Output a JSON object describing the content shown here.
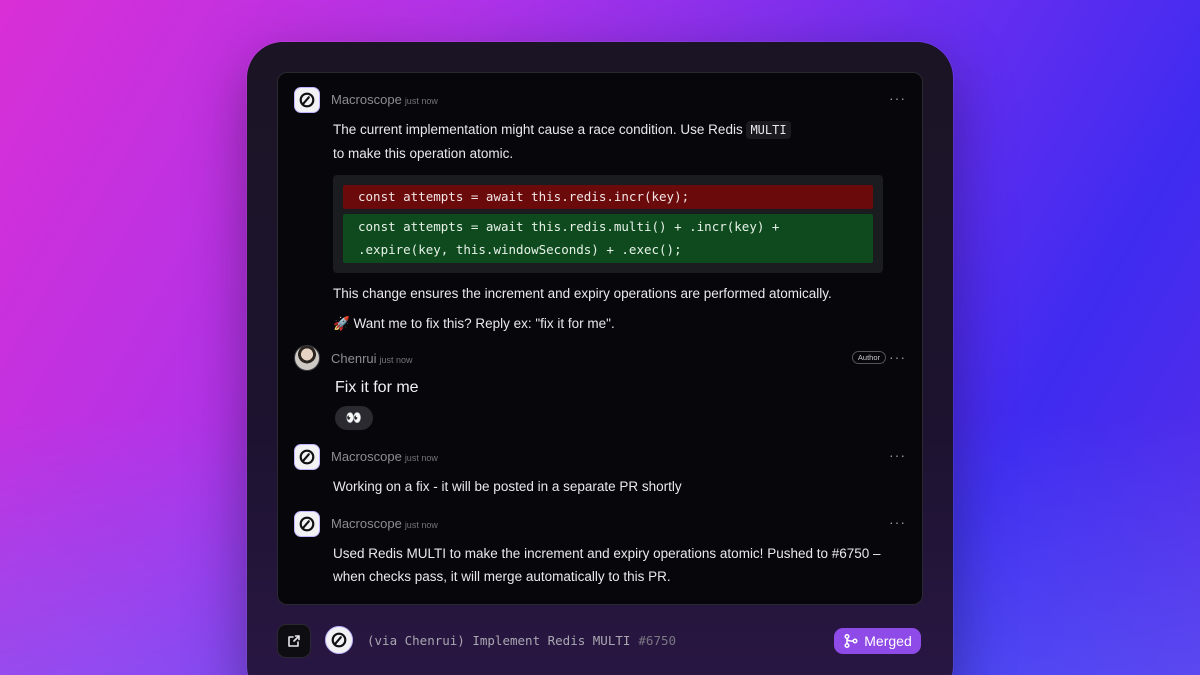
{
  "comments": [
    {
      "author": "Macroscope",
      "time": "just now",
      "text_line1_pre": "The current implementation might cause a race condition. Use Redis ",
      "inline_code": "MULTI",
      "text_line2": " to make this operation atomic.",
      "diff_removed": "const attempts = await this.redis.incr(key);",
      "diff_added_line1": "const attempts = await this.redis.multi() + .incr(key) +",
      "diff_added_line2": ".expire(key, this.windowSeconds) + .exec();",
      "after_text": "This change ensures the increment and expiry operations are performed atomically.",
      "cta": "🚀 Want me to fix this? Reply ex: \"fix it for me\"."
    },
    {
      "author": "Chenrui",
      "time": "just now",
      "badge": "Author",
      "text": "Fix it for me",
      "reaction": "👀"
    },
    {
      "author": "Macroscope",
      "time": "just now",
      "text": "Working on a fix - it will be posted in a separate PR shortly"
    },
    {
      "author": "Macroscope",
      "time": "just now",
      "text_line1": "Used Redis MULTI to make the increment and expiry operations atomic! Pushed to #6750 –",
      "text_line2": "when checks pass, it will merge automatically to this PR."
    }
  ],
  "more_label": "···",
  "footer": {
    "title": "(via Chenrui) Implement Redis MULTI",
    "pr_number": "#6750",
    "status": "Merged",
    "status_color": "#8e4be8"
  },
  "icons": [
    "macroscope-logo-icon",
    "more-icon",
    "external-link-icon",
    "merge-icon"
  ]
}
